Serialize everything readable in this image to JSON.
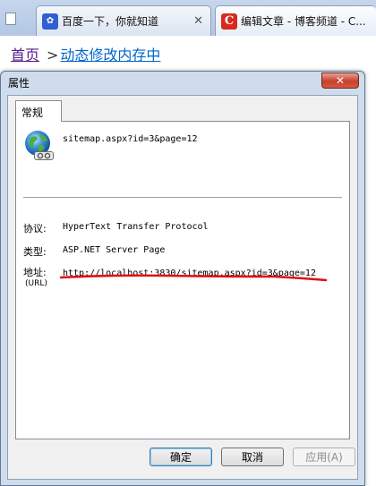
{
  "browser": {
    "tabs": [
      {
        "label": "百度一下，你就知道",
        "icon": "baidu-paw-icon",
        "icon_glyph": "✿"
      },
      {
        "label": "编辑文章 - 博客频道 - C...",
        "icon": "csdn-c-icon",
        "icon_glyph": "C"
      }
    ],
    "tab_close_glyph": "✕"
  },
  "page": {
    "breadcrumb": {
      "home": "首页",
      "separator": ">",
      "current": "动态修改内存中"
    }
  },
  "dialog": {
    "title": "属性",
    "close_glyph": "✕",
    "tab_general": "常规",
    "file_name": "sitemap.aspx?id=3&page=12",
    "protocol_label": "协议:",
    "protocol_value": "HyperText Transfer Protocol",
    "type_label": "类型:",
    "type_value": "ASP.NET Server Page",
    "address_label": "地址:",
    "address_sub_label": "(URL)",
    "address_value": "http://localhost:3830/sitemap.aspx?id=3&page=12",
    "buttons": {
      "ok": "确定",
      "cancel": "取消",
      "apply": "应用(A)"
    }
  },
  "colors": {
    "annotation_red": "#e01010",
    "link_visited": "#551a8b",
    "link": "#0066cc",
    "close_button": "#c7402d"
  }
}
